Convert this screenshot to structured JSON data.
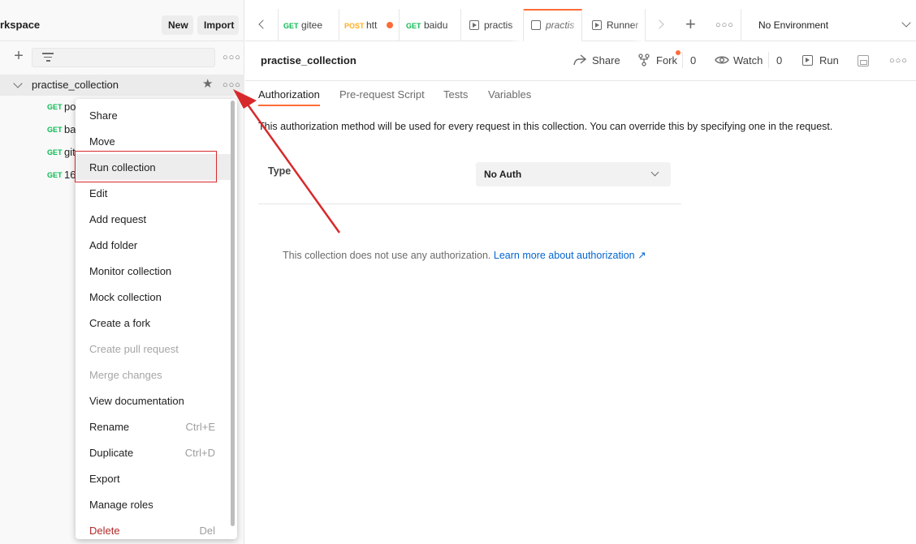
{
  "sidebar": {
    "workspace_title": "rkspace",
    "new_label": "New",
    "import_label": "Import",
    "collection_name": "practise_collection",
    "requests": [
      {
        "method": "GET",
        "name": "po"
      },
      {
        "method": "GET",
        "name": "ba"
      },
      {
        "method": "GET",
        "name": "git"
      },
      {
        "method": "GET",
        "name": "16"
      }
    ]
  },
  "menu": {
    "items": [
      {
        "label": "Share",
        "shortcut": ""
      },
      {
        "label": "Move",
        "shortcut": ""
      },
      {
        "label": "Run collection",
        "shortcut": ""
      },
      {
        "label": "Edit",
        "shortcut": ""
      },
      {
        "label": "Add request",
        "shortcut": ""
      },
      {
        "label": "Add folder",
        "shortcut": ""
      },
      {
        "label": "Monitor collection",
        "shortcut": ""
      },
      {
        "label": "Mock collection",
        "shortcut": ""
      },
      {
        "label": "Create a fork",
        "shortcut": ""
      },
      {
        "label": "Create pull request",
        "shortcut": ""
      },
      {
        "label": "Merge changes",
        "shortcut": ""
      },
      {
        "label": "View documentation",
        "shortcut": ""
      },
      {
        "label": "Rename",
        "shortcut": "Ctrl+E"
      },
      {
        "label": "Duplicate",
        "shortcut": "Ctrl+D"
      },
      {
        "label": "Export",
        "shortcut": ""
      },
      {
        "label": "Manage roles",
        "shortcut": ""
      },
      {
        "label": "Delete",
        "shortcut": "Del"
      }
    ]
  },
  "tabs": [
    {
      "method": "GET",
      "name": "gitee"
    },
    {
      "method": "POST",
      "name": "htt"
    },
    {
      "method": "GET",
      "name": "baidu"
    },
    {
      "method": "",
      "name": "practis"
    },
    {
      "method": "",
      "name": "practis"
    },
    {
      "method": "",
      "name": "Runner"
    }
  ],
  "environment": {
    "label": "No Environment"
  },
  "header": {
    "title": "practise_collection",
    "share_label": "Share",
    "fork_label": "Fork",
    "fork_count": "0",
    "watch_label": "Watch",
    "watch_count": "0",
    "run_label": "Run"
  },
  "subtabs": [
    "Authorization",
    "Pre-request Script",
    "Tests",
    "Variables"
  ],
  "auth": {
    "description": "This authorization method will be used for every request in this collection. You can override this by specifying one in the request.",
    "type_label": "Type",
    "type_value": "No Auth",
    "no_auth_text": "This collection does not use any authorization.",
    "learn_more": "Learn more about authorization ↗"
  },
  "colors": {
    "accent": "#ff6c37",
    "get": "#0cbb52",
    "post": "#ffad20",
    "annotation": "#d7292b",
    "link": "#0265d2",
    "danger": "#b02a2a"
  }
}
